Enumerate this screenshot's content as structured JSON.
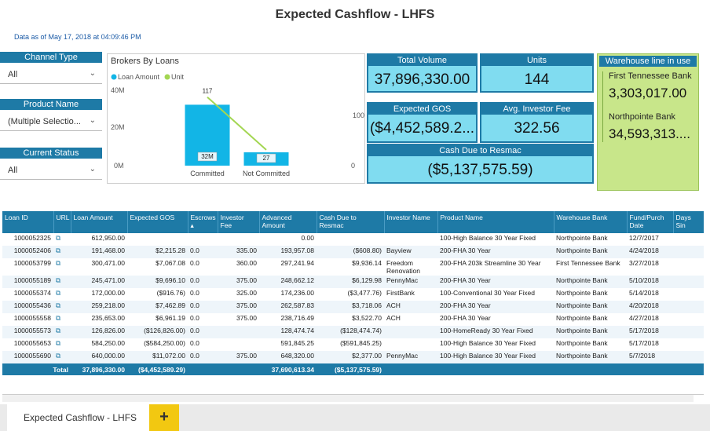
{
  "page": {
    "title": "Expected Cashflow - LHFS",
    "as_of": "Data as of May 17, 2018 at 04:09:46 PM"
  },
  "slicers": [
    {
      "label": "Channel Type",
      "value": "All"
    },
    {
      "label": "Product Name",
      "value": "(Multiple Selectio..."
    },
    {
      "label": "Current Status",
      "value": "All"
    }
  ],
  "chart": {
    "title": "Brokers By Loans",
    "legend": {
      "loan_amount": "Loan Amount",
      "unit": "Unit"
    },
    "y_left_ticks": [
      "40M",
      "20M",
      "0M"
    ],
    "y_right_ticks": [
      "100",
      "0"
    ]
  },
  "chart_data": {
    "type": "bar",
    "title": "Brokers By Loans",
    "categories": [
      "Committed",
      "Not Committed"
    ],
    "series": [
      {
        "name": "Loan Amount",
        "type": "bar",
        "values": [
          32,
          7
        ],
        "labels": [
          "32M",
          "27"
        ]
      },
      {
        "name": "Unit",
        "type": "line",
        "values": [
          117,
          27
        ],
        "labels": [
          "117",
          ""
        ]
      }
    ],
    "ylim_left": [
      0,
      40
    ],
    "ylim_right": [
      0,
      130
    ],
    "colors": {
      "bar": "#12b5e6",
      "line": "#a3d652"
    }
  },
  "kpis": {
    "total_volume": {
      "label": "Total Volume",
      "value": "37,896,330.00"
    },
    "units": {
      "label": "Units",
      "value": "144"
    },
    "expected_gos": {
      "label": "Expected GOS",
      "value": "($4,452,589.2..."
    },
    "avg_investor_fee": {
      "label": "Avg. Investor Fee",
      "value": "322.56"
    },
    "cash_due": {
      "label": "Cash Due to Resmac",
      "value": "($5,137,575.59)"
    }
  },
  "warehouse": {
    "label": "Warehouse line in use",
    "banks": [
      {
        "name": "First Tennessee Bank",
        "value": "3,303,017.00"
      },
      {
        "name": "Northpointe Bank",
        "value": "34,593,313...."
      }
    ]
  },
  "table": {
    "headers": [
      "Loan ID",
      "URL",
      "Loan Amount",
      "Expected GOS",
      "Escrows",
      "Investor Fee",
      "Advanced Amount",
      "Cash Due to Resmac",
      "Investor Name",
      "Product Name",
      "Warehouse Bank",
      "Fund/Purch Date",
      "Days Sin"
    ],
    "rows": [
      [
        "1000052325",
        "612,950.00",
        "",
        "",
        "",
        "0.00",
        "",
        "",
        "100-High Balance 30 Year Fixed",
        "Northpointe Bank",
        "12/7/2017"
      ],
      [
        "1000052406",
        "191,468.00",
        "$2,215.28",
        "0.0",
        "335.00",
        "193,957.08",
        "($608.80)",
        "Bayview",
        "200-FHA 30 Year",
        "Northpointe Bank",
        "4/24/2018"
      ],
      [
        "1000053799",
        "300,471.00",
        "$7,067.08",
        "0.0",
        "360.00",
        "297,241.94",
        "$9,936.14",
        "Freedom Renovation",
        "200-FHA 203k Streamline 30 Year",
        "First Tennessee Bank",
        "3/27/2018"
      ],
      [
        "1000055189",
        "245,471.00",
        "$9,696.10",
        "0.0",
        "375.00",
        "248,662.12",
        "$6,129.98",
        "PennyMac",
        "200-FHA 30 Year",
        "Northpointe Bank",
        "5/10/2018"
      ],
      [
        "1000055374",
        "172,000.00",
        "($916.76)",
        "0.0",
        "325.00",
        "174,236.00",
        "($3,477.76)",
        "FirstBank",
        "100-Conventional 30 Year Fixed",
        "Northpointe Bank",
        "5/14/2018"
      ],
      [
        "1000055436",
        "259,218.00",
        "$7,462.89",
        "0.0",
        "375.00",
        "262,587.83",
        "$3,718.06",
        "ACH",
        "200-FHA 30 Year",
        "Northpointe Bank",
        "4/20/2018"
      ],
      [
        "1000055558",
        "235,653.00",
        "$6,961.19",
        "0.0",
        "375.00",
        "238,716.49",
        "$3,522.70",
        "ACH",
        "200-FHA 30 Year",
        "Northpointe Bank",
        "4/27/2018"
      ],
      [
        "1000055573",
        "126,826.00",
        "($126,826.00)",
        "0.0",
        "",
        "128,474.74",
        "($128,474.74)",
        "",
        "100-HomeReady 30 Year Fixed",
        "Northpointe Bank",
        "5/17/2018"
      ],
      [
        "1000055653",
        "584,250.00",
        "($584,250.00)",
        "0.0",
        "",
        "591,845.25",
        "($591,845.25)",
        "",
        "100-High Balance 30 Year Fixed",
        "Northpointe Bank",
        "5/17/2018"
      ],
      [
        "1000055690",
        "640,000.00",
        "$11,072.00",
        "0.0",
        "375.00",
        "648,320.00",
        "$2,377.00",
        "PennyMac",
        "100-High Balance 30 Year Fixed",
        "Northpointe Bank",
        "5/7/2018"
      ]
    ],
    "total": {
      "label": "Total",
      "loan_amount": "37,896,330.00",
      "expected_gos": "($4,452,589.29)",
      "advanced_amount": "37,690,613.34",
      "cash_due": "($5,137,575.59)"
    }
  },
  "tabs": {
    "active": "Expected Cashflow - LHFS",
    "add": "+"
  },
  "colors": {
    "header": "#1e7aa6",
    "kpi": "#80dcf0",
    "warehouse": "#c8e68a",
    "tab_add": "#f2c811"
  }
}
